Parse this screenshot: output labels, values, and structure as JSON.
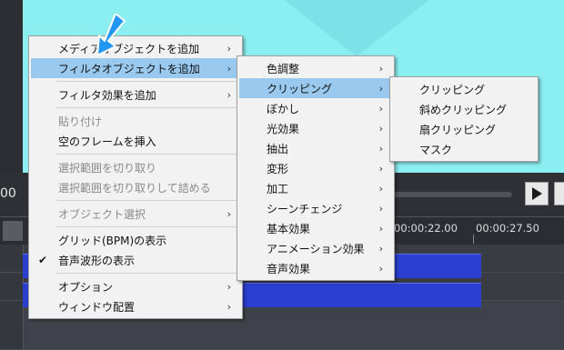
{
  "timeline": {
    "time_readout": "00",
    "ruler_labels": [
      "00:00:22.00",
      "00:00:27.50"
    ]
  },
  "context_menu": {
    "items": [
      {
        "label": "メディアオブジェクトを追加",
        "submenu": true
      },
      {
        "label": "フィルタオブジェクトを追加",
        "submenu": true,
        "highlighted": true
      },
      {
        "label": "フィルタ効果を追加",
        "submenu": true
      },
      {
        "label": "貼り付け",
        "disabled": true
      },
      {
        "label": "空のフレームを挿入"
      },
      {
        "label": "選択範囲を切り取り",
        "disabled": true
      },
      {
        "label": "選択範囲を切り取りして詰める",
        "disabled": true
      },
      {
        "label": "オブジェクト選択",
        "submenu": true,
        "disabled": true
      },
      {
        "label": "グリッド(BPM)の表示"
      },
      {
        "label": "音声波形の表示",
        "checked": true
      },
      {
        "label": "オプション",
        "submenu": true
      },
      {
        "label": "ウィンドウ配置",
        "submenu": true
      }
    ]
  },
  "filter_submenu": {
    "items": [
      {
        "label": "色調整"
      },
      {
        "label": "クリッピング",
        "highlighted": true
      },
      {
        "label": "ぼかし"
      },
      {
        "label": "光効果"
      },
      {
        "label": "抽出"
      },
      {
        "label": "変形"
      },
      {
        "label": "加工"
      },
      {
        "label": "シーンチェンジ"
      },
      {
        "label": "基本効果"
      },
      {
        "label": "アニメーション効果"
      },
      {
        "label": "音声効果"
      }
    ]
  },
  "clipping_submenu": {
    "items": [
      {
        "label": "クリッピング"
      },
      {
        "label": "斜めクリッピング"
      },
      {
        "label": "扇クリッピング"
      },
      {
        "label": "マスク"
      }
    ]
  },
  "glyphs": {
    "submenu_arrow": "›",
    "check": "✔"
  },
  "colors": {
    "highlight": "#99c9ef",
    "preview": "#8beff1",
    "clip": "#2b3fd0",
    "cursor": "#2196f3"
  }
}
